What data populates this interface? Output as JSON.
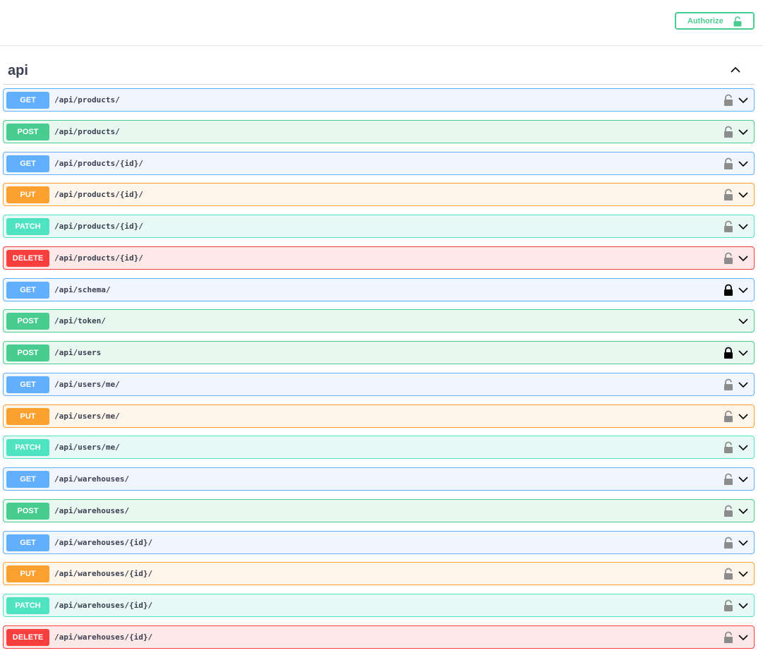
{
  "topbar": {
    "authorize_label": "Authorize"
  },
  "tag": {
    "name": "api",
    "expanded": true
  },
  "colors": {
    "GET": {
      "bg": "#eff6fe",
      "border": "#61affe",
      "badge": "#61affe"
    },
    "POST": {
      "bg": "#e9f7f1",
      "border": "#49cc90",
      "badge": "#49cc90"
    },
    "PUT": {
      "bg": "#fef5ea",
      "border": "#fca130",
      "badge": "#fca130"
    },
    "PATCH": {
      "bg": "#e8f8f4",
      "border": "#50e3c2",
      "badge": "#50e3c2"
    },
    "DELETE": {
      "bg": "#fde8e8",
      "border": "#f93e3e",
      "badge": "#f93e3e"
    }
  },
  "operations": [
    {
      "method": "GET",
      "path": "/api/products/",
      "lock": "open"
    },
    {
      "method": "POST",
      "path": "/api/products/",
      "lock": "open"
    },
    {
      "method": "GET",
      "path": "/api/products/{id}/",
      "lock": "open"
    },
    {
      "method": "PUT",
      "path": "/api/products/{id}/",
      "lock": "open"
    },
    {
      "method": "PATCH",
      "path": "/api/products/{id}/",
      "lock": "open"
    },
    {
      "method": "DELETE",
      "path": "/api/products/{id}/",
      "lock": "open"
    },
    {
      "method": "GET",
      "path": "/api/schema/",
      "lock": "closed"
    },
    {
      "method": "POST",
      "path": "/api/token/",
      "lock": "none"
    },
    {
      "method": "POST",
      "path": "/api/users",
      "lock": "closed"
    },
    {
      "method": "GET",
      "path": "/api/users/me/",
      "lock": "open"
    },
    {
      "method": "PUT",
      "path": "/api/users/me/",
      "lock": "open"
    },
    {
      "method": "PATCH",
      "path": "/api/users/me/",
      "lock": "open"
    },
    {
      "method": "GET",
      "path": "/api/warehouses/",
      "lock": "open"
    },
    {
      "method": "POST",
      "path": "/api/warehouses/",
      "lock": "open"
    },
    {
      "method": "GET",
      "path": "/api/warehouses/{id}/",
      "lock": "open"
    },
    {
      "method": "PUT",
      "path": "/api/warehouses/{id}/",
      "lock": "open"
    },
    {
      "method": "PATCH",
      "path": "/api/warehouses/{id}/",
      "lock": "open"
    },
    {
      "method": "DELETE",
      "path": "/api/warehouses/{id}/",
      "lock": "open"
    }
  ]
}
